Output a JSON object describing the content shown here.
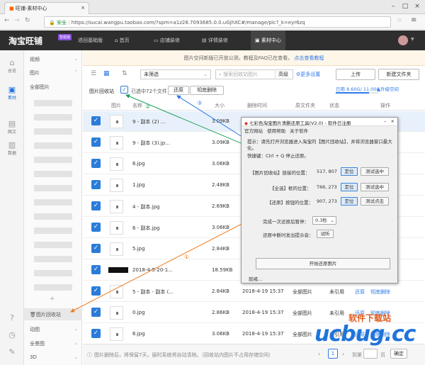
{
  "browser": {
    "tab_title": "旺铺-素材中心",
    "secure_label": "安全",
    "url": "https://sucai.wangpu.taobao.com/?spm=a1z28.7093685.0.0.uGjhXC#/manage/pic?_k=eyr6zq"
  },
  "topnav": {
    "logo": "淘宝旺铺",
    "badge": "智能版",
    "items": [
      "退回基础版",
      "首页",
      "店铺装修",
      "详情装修",
      "素材中心"
    ],
    "new_tag": "NEW"
  },
  "sidebar": {
    "items": [
      {
        "icon": "home-icon",
        "label": "总览"
      },
      {
        "icon": "material-icon",
        "label": "素材"
      },
      {
        "icon": "text-icon",
        "label": "图文"
      },
      {
        "icon": "data-icon",
        "label": "数据"
      }
    ],
    "bottom_icons": [
      "help-icon",
      "clock-icon",
      "edit-icon"
    ]
  },
  "tree": {
    "video": "视频",
    "image": "图片",
    "all_images": "全部图片",
    "recycle": "图片回收站",
    "animation": "动图",
    "panorama": "全景图",
    "threed": "3D"
  },
  "notice": {
    "text": "图片空间新版已开放公测，教程及FAQ已在查看。",
    "link": "点击查看教程"
  },
  "toolbar": {
    "filter_value": "未筛选",
    "search_placeholder": "搜索回收站图片",
    "advanced": "高级",
    "more_settings": "更多设置",
    "upload": "上传",
    "new_folder": "新建文件夹",
    "usage": "已用 8.60G/ 11.00G",
    "upgrade": "升级空间",
    "usage_fraction": 0.78
  },
  "recycle": {
    "title": "图片回收站",
    "selected": "已选中72个文件",
    "restore": "还原",
    "delete_perm": "彻底删除"
  },
  "columns": [
    "图片",
    "名称",
    "大小",
    "删除时间",
    "原文件夹",
    "状态",
    "操作"
  ],
  "rows": [
    {
      "name": "9 - 副本 (2) ...",
      "size": "3.09KB",
      "date": "",
      "folder": "",
      "status": "",
      "thumb": "light"
    },
    {
      "name": "9 - 副本 (3).jp...",
      "size": "3.09KB",
      "date": "",
      "folder": "",
      "status": "",
      "thumb": "light"
    },
    {
      "name": "6.jpg",
      "size": "3.06KB",
      "date": "",
      "folder": "",
      "status": "",
      "thumb": "light"
    },
    {
      "name": "1.jpg",
      "size": "2.48KB",
      "date": "",
      "folder": "",
      "status": "",
      "thumb": "light"
    },
    {
      "name": "4 - 副本.jpg",
      "size": "2.69KB",
      "date": "",
      "folder": "",
      "status": "",
      "thumb": "light"
    },
    {
      "name": "6 - 副本.jpg",
      "size": "3.06KB",
      "date": "",
      "folder": "",
      "status": "",
      "thumb": "light"
    },
    {
      "name": "5.jpg",
      "size": "2.84KB",
      "date": "",
      "folder": "",
      "status": "",
      "thumb": "light"
    },
    {
      "name": "2018-4-5-20-1...",
      "size": "18.59KB",
      "date": "",
      "folder": "",
      "status": "",
      "thumb": "dark"
    },
    {
      "name": "5 - 副本 - 副本 (...",
      "size": "2.84KB",
      "date": "2018-4-19 15:37",
      "folder": "全部图片",
      "status": "未引用",
      "thumb": "light"
    },
    {
      "name": "0.jpg",
      "size": "2.86KB",
      "date": "2018-4-19 15:37",
      "folder": "全部图片",
      "status": "未引用",
      "thumb": "light"
    },
    {
      "name": "6.jpg",
      "size": "3.06KB",
      "date": "2018-4-19 15:37",
      "folder": "全部图片",
      "status": "未引用",
      "thumb": "light"
    }
  ],
  "row_actions": {
    "restore": "还原",
    "delete": "彻底删除"
  },
  "footer": {
    "note": "图片删除后，将保留7天，届时系统将自动清除。（回收站内图片不占用存储空间）",
    "page": "1",
    "goto_label": "到第",
    "page_unit": "页",
    "confirm": "确定"
  },
  "dialog": {
    "title": "七彩色淘宝图片清删还原工具(V2.0) - 软件已注册",
    "menu": [
      "官方网站",
      "使用帮助",
      "关于软件"
    ],
    "instr1": "提示：请先打开浏览器进入淘宝的【图片回收站】，并将浏览器窗口最大化。",
    "instr2": "快捷键：Ctrl + Q 停止还原。",
    "fields": [
      {
        "label": "【图片回收站】链接的位置：",
        "value": "517, 807",
        "locate": "定位",
        "test": "测试选中"
      },
      {
        "label": "【全选】框的位置：",
        "value": "T66, 273",
        "locate": "定位",
        "test": "测试选中"
      },
      {
        "label": "【还原】按钮的位置：",
        "value": "907, 273",
        "locate": "定位",
        "test": "测试点击"
      }
    ],
    "pause_label": "完成一次还原后暂停：",
    "pause_value": "0.3秒",
    "prompt_label": "还原中断时发出提示音：",
    "prompt_btn": "试听",
    "start": "开始还原图片",
    "status": "就绪..."
  },
  "annotations": {
    "a1": "①",
    "a2": "②",
    "a3": "③",
    "blue": "#2f7ae5",
    "green": "#1aa05a",
    "orange": "#f07a1a"
  },
  "watermark": {
    "cn": "软件下载站",
    "en": "ucbug.cc"
  }
}
